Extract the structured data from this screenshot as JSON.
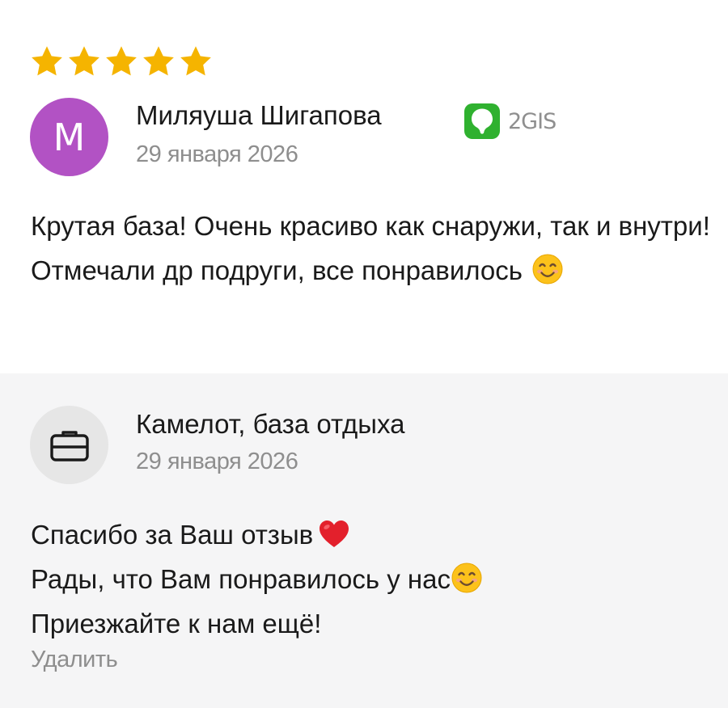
{
  "review": {
    "rating": 5,
    "rating_max": 5,
    "star_color": "#f5b400",
    "author": {
      "initial": "М",
      "name": "Миляуша Шигапова",
      "avatar_color": "#b252c4"
    },
    "source": {
      "label": "2GIS",
      "icon": "2gis-logo-icon",
      "color": "#2fb12f"
    },
    "date": "29 января 2026",
    "text": "Крутая база! Очень красиво как снаружи, так и внутри! Отмечали др подруги, все понравилось",
    "text_emoji": "smiling-face-icon"
  },
  "reply": {
    "author": {
      "name": "Камелот, база отдыха",
      "avatar_icon": "briefcase-icon"
    },
    "date": "29 января 2026",
    "lines": [
      "Спасибо за Ваш отзыв",
      "Рады, что Вам понравилось у нас",
      "Приезжайте к нам ещё!"
    ],
    "line_emojis": [
      "heart-icon",
      "smiling-face-icon"
    ],
    "delete_label": "Удалить"
  }
}
